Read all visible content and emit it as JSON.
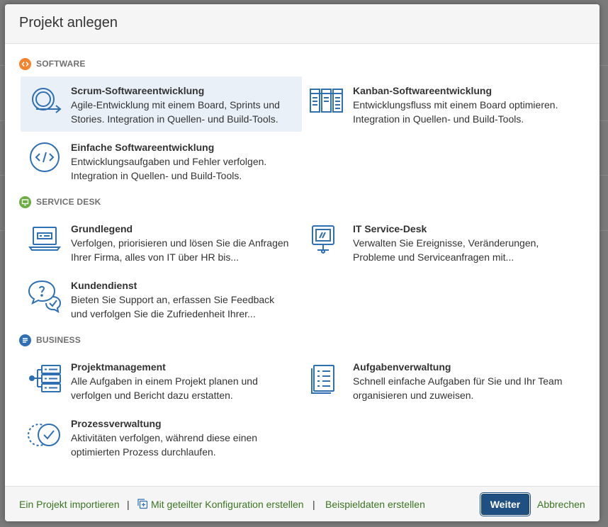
{
  "dialog": {
    "title": "Projekt anlegen"
  },
  "sections": [
    {
      "label": "SOFTWARE",
      "color": "#f6822b",
      "items": [
        {
          "title": "Scrum-Softwareentwicklung",
          "desc1": "Agile-Entwicklung mit einem Board, Sprints und",
          "desc2": "Stories. Integration in Quellen- und Build-Tools.",
          "icon": "scrum-icon",
          "selected": true
        },
        {
          "title": "Kanban-Softwareentwicklung",
          "desc1": "Entwicklungsfluss mit einem Board optimieren.",
          "desc2": "Integration in Quellen- und Build-Tools.",
          "icon": "kanban-board-icon"
        },
        {
          "title": "Einfache Softwareentwicklung",
          "desc1": "Entwicklungsaufgaben und Fehler verfolgen.",
          "desc2": "Integration in Quellen- und Build-Tools.",
          "icon": "code-icon"
        }
      ]
    },
    {
      "label": "SERVICE DESK",
      "color": "#6aad43",
      "items": [
        {
          "title": "Grundlegend",
          "desc1": "Verfolgen, priorisieren und lösen Sie die Anfragen",
          "desc2": "Ihrer Firma, alles von IT über HR bis...",
          "icon": "laptop-icon"
        },
        {
          "title": "IT Service-Desk",
          "desc1": "Verwalten Sie Ereignisse, Veränderungen,",
          "desc2": "Probleme und Serviceanfragen mit...",
          "icon": "monitor-icon"
        },
        {
          "title": "Kundendienst",
          "desc1": "Bieten Sie Support an, erfassen Sie Feedback",
          "desc2": "und verfolgen Sie die Zufriedenheit Ihrer...",
          "icon": "chat-bubbles-icon"
        }
      ]
    },
    {
      "label": "BUSINESS",
      "color": "#2f6fb4",
      "items": [
        {
          "title": "Projektmanagement",
          "desc1": "Alle Aufgaben in einem Projekt planen und",
          "desc2": "verfolgen und Bericht dazu erstatten.",
          "icon": "project-tree-icon"
        },
        {
          "title": "Aufgabenverwaltung",
          "desc1": "Schnell einfache Aufgaben für Sie und Ihr Team",
          "desc2": "organisieren und zuweisen.",
          "icon": "task-list-icon"
        },
        {
          "title": "Prozessverwaltung",
          "desc1": "Aktivitäten verfolgen, während diese einen",
          "desc2": "optimierten Prozess durchlaufen.",
          "icon": "process-check-icon"
        }
      ]
    }
  ],
  "footer": {
    "import_link": "Ein Projekt importieren",
    "separator": "|",
    "shared_config_link": "Mit geteilter Konfiguration erstellen",
    "sample_data_link": "Beispieldaten erstellen",
    "next_button": "Weiter",
    "cancel_link": "Abbrechen"
  },
  "colors": {
    "accent": "#205081",
    "link": "#3b7524",
    "icon_stroke": "#2f6fb4",
    "selected_bg": "#e9f0f8"
  }
}
